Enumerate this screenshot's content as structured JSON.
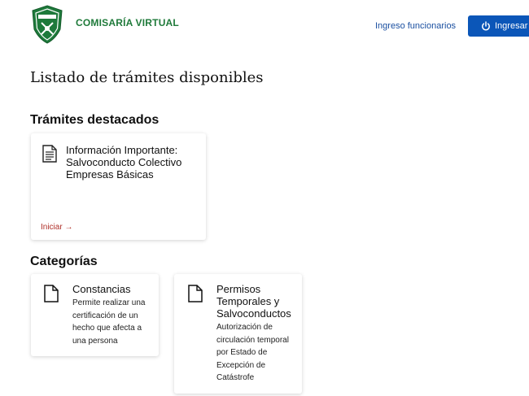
{
  "header": {
    "logo_icon": "carabineros-crest-icon",
    "brand": "COMISARÍA VIRTUAL",
    "staff_link": "Ingreso funcionarios",
    "login_button": "Ingresar c",
    "login_icon": "power-icon",
    "accent_color": "#0b56b8",
    "brand_color": "#1f7a3a"
  },
  "main": {
    "title": "Listado de trámites disponibles",
    "featured": {
      "heading": "Trámites destacados",
      "cards": [
        {
          "icon": "document-icon",
          "title": "Información Importante: Salvoconducto Colectivo Empresas Básicas",
          "action": "Iniciar →"
        }
      ]
    },
    "categories": {
      "heading": "Categorías",
      "cards": [
        {
          "icon": "file-icon",
          "title": "Constancias",
          "description": "Permite realizar una certificación de un hecho que afecta a una persona"
        },
        {
          "icon": "file-icon",
          "title": "Permisos Temporales y Salvoconductos",
          "description": "Autorización de circulación temporal por Estado de Excepción de Catástrofe"
        }
      ]
    }
  }
}
